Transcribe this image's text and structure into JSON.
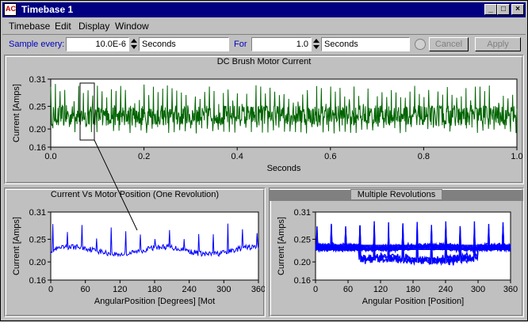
{
  "window": {
    "title": "Timebase 1",
    "icon_letters": "AC",
    "min_icon": "minimize-icon",
    "max_icon": "maximize-icon",
    "close_icon": "close-icon"
  },
  "menu": [
    {
      "label": "Timebase"
    },
    {
      "label": "Edit"
    },
    {
      "label": "Display"
    },
    {
      "label": "Window"
    }
  ],
  "toolbar": {
    "sample_label": "Sample every:",
    "sample_value": "10.0E-6",
    "sample_unit": "Seconds",
    "for_label": "For",
    "for_value": "1.0",
    "for_unit": "Seconds",
    "cancel_label": "Cancel",
    "apply_label": "Apply"
  },
  "colors": {
    "green": "#006400",
    "blue": "#0000ff",
    "highlight": "#808080"
  },
  "chart_data": [
    {
      "type": "line",
      "title": "DC Brush Motor Current",
      "xlabel": "Seconds",
      "ylabel": "Current [Amps]",
      "xlim": [
        0,
        1.0
      ],
      "ylim": [
        0.16,
        0.31
      ],
      "xticks": [
        "0.0",
        "0.2",
        "0.4",
        "0.6",
        "0.8",
        "1.0"
      ],
      "yticks": [
        "0.16",
        "0.20",
        "0.25",
        "0.31"
      ],
      "series": [
        {
          "mean": 0.23,
          "noise_range": [
            0.18,
            0.3
          ]
        }
      ]
    },
    {
      "type": "line",
      "title": "Current Vs Motor Position (One Revolution)",
      "xlabel": "AngularPosition [Degrees] [Mot",
      "ylabel": "Current [Amps]",
      "xlim": [
        0,
        360
      ],
      "ylim": [
        0.16,
        0.31
      ],
      "xticks": [
        "0",
        "60",
        "120",
        "180",
        "240",
        "300",
        "360"
      ],
      "yticks": [
        "0.16",
        "0.20",
        "0.25",
        "0.31"
      ],
      "series": [
        {
          "mean": 0.225
        }
      ]
    },
    {
      "type": "line",
      "title": "Multiple Revolutions",
      "xlabel": "Angular Position [Position]",
      "ylabel": "Current [Amps]",
      "xlim": [
        0,
        360
      ],
      "ylim": [
        0.16,
        0.31
      ],
      "xticks": [
        "0",
        "60",
        "120",
        "180",
        "240",
        "300",
        "360"
      ],
      "yticks": [
        "0.16",
        "0.20",
        "0.25",
        "0.31"
      ],
      "series": [
        {
          "mean": 0.23
        }
      ]
    }
  ]
}
